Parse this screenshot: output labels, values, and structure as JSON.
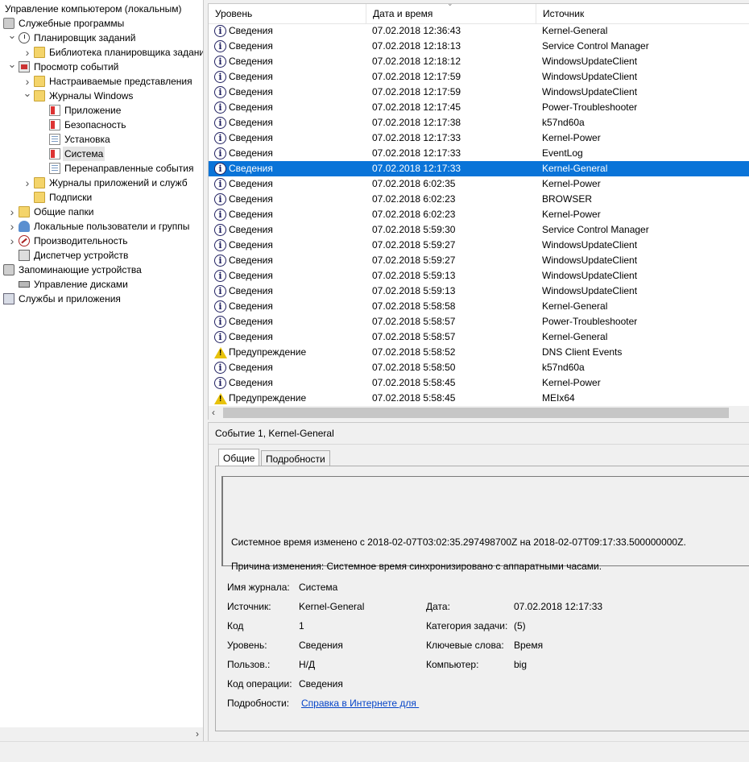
{
  "tree": {
    "items": [
      {
        "label": "Управление компьютером (локальным)",
        "indent": 0,
        "arrow": "",
        "icon": "computer-management-icon",
        "iconClass": "",
        "selected": false
      },
      {
        "label": "Служебные программы",
        "indent": 0,
        "arrow": "",
        "icon": "tools-icon",
        "iconClass": "ic-tools",
        "selected": false
      },
      {
        "label": "Планировщик заданий",
        "indent": 1,
        "arrow": "down",
        "icon": "clock-icon",
        "iconClass": "ic-clock",
        "selected": false
      },
      {
        "label": "Библиотека планировщика заданий",
        "indent": 2,
        "arrow": "right",
        "icon": "folder-icon",
        "iconClass": "ic-folder",
        "selected": false
      },
      {
        "label": "Просмотр событий",
        "indent": 1,
        "arrow": "down",
        "icon": "event-viewer-icon",
        "iconClass": "ic-ev",
        "selected": false
      },
      {
        "label": "Настраиваемые представления",
        "indent": 2,
        "arrow": "right",
        "icon": "folder-icon",
        "iconClass": "ic-folder",
        "selected": false
      },
      {
        "label": "Журналы Windows",
        "indent": 2,
        "arrow": "down",
        "icon": "windows-logs-icon",
        "iconClass": "ic-folder",
        "selected": false
      },
      {
        "label": "Приложение",
        "indent": 3,
        "arrow": "",
        "icon": "log-icon",
        "iconClass": "ic-logs",
        "selected": false
      },
      {
        "label": "Безопасность",
        "indent": 3,
        "arrow": "",
        "icon": "log-icon",
        "iconClass": "ic-logs",
        "selected": false
      },
      {
        "label": "Установка",
        "indent": 3,
        "arrow": "",
        "icon": "log-icon",
        "iconClass": "ic-log",
        "selected": false
      },
      {
        "label": "Система",
        "indent": 3,
        "arrow": "",
        "icon": "log-icon",
        "iconClass": "ic-logs",
        "selected": true
      },
      {
        "label": "Перенаправленные события",
        "indent": 3,
        "arrow": "",
        "icon": "log-icon",
        "iconClass": "ic-log",
        "selected": false
      },
      {
        "label": "Журналы приложений и служб",
        "indent": 2,
        "arrow": "right",
        "icon": "folder-icon",
        "iconClass": "ic-folder",
        "selected": false
      },
      {
        "label": "Подписки",
        "indent": 2,
        "arrow": "",
        "icon": "subscriptions-icon",
        "iconClass": "ic-folder",
        "selected": false
      },
      {
        "label": "Общие папки",
        "indent": 1,
        "arrow": "right",
        "icon": "shared-folders-icon",
        "iconClass": "ic-folder",
        "selected": false
      },
      {
        "label": "Локальные пользователи и группы",
        "indent": 1,
        "arrow": "right",
        "icon": "users-icon",
        "iconClass": "ic-users",
        "selected": false
      },
      {
        "label": "Производительность",
        "indent": 1,
        "arrow": "right",
        "icon": "performance-icon",
        "iconClass": "ic-perf",
        "selected": false
      },
      {
        "label": "Диспетчер устройств",
        "indent": 1,
        "arrow": "",
        "icon": "device-manager-icon",
        "iconClass": "ic-dev",
        "selected": false
      },
      {
        "label": "Запоминающие устройства",
        "indent": 0,
        "arrow": "",
        "icon": "storage-icon",
        "iconClass": "ic-storage",
        "selected": false
      },
      {
        "label": "Управление дисками",
        "indent": 1,
        "arrow": "",
        "icon": "disk-icon",
        "iconClass": "ic-disk",
        "selected": false
      },
      {
        "label": "Службы и приложения",
        "indent": 0,
        "arrow": "",
        "icon": "services-icon",
        "iconClass": "ic-svc",
        "selected": false
      }
    ]
  },
  "list": {
    "columns": {
      "level": "Уровень",
      "datetime": "Дата и время",
      "source": "Источник"
    },
    "rows": [
      {
        "level": "Сведения",
        "type": "info",
        "datetime": "07.02.2018 12:36:43",
        "source": "Kernel-General",
        "selected": false
      },
      {
        "level": "Сведения",
        "type": "info",
        "datetime": "07.02.2018 12:18:13",
        "source": "Service Control Manager",
        "selected": false
      },
      {
        "level": "Сведения",
        "type": "info",
        "datetime": "07.02.2018 12:18:12",
        "source": "WindowsUpdateClient",
        "selected": false
      },
      {
        "level": "Сведения",
        "type": "info",
        "datetime": "07.02.2018 12:17:59",
        "source": "WindowsUpdateClient",
        "selected": false
      },
      {
        "level": "Сведения",
        "type": "info",
        "datetime": "07.02.2018 12:17:59",
        "source": "WindowsUpdateClient",
        "selected": false
      },
      {
        "level": "Сведения",
        "type": "info",
        "datetime": "07.02.2018 12:17:45",
        "source": "Power-Troubleshooter",
        "selected": false
      },
      {
        "level": "Сведения",
        "type": "info",
        "datetime": "07.02.2018 12:17:38",
        "source": "k57nd60a",
        "selected": false
      },
      {
        "level": "Сведения",
        "type": "info",
        "datetime": "07.02.2018 12:17:33",
        "source": "Kernel-Power",
        "selected": false
      },
      {
        "level": "Сведения",
        "type": "info",
        "datetime": "07.02.2018 12:17:33",
        "source": "EventLog",
        "selected": false
      },
      {
        "level": "Сведения",
        "type": "info",
        "datetime": "07.02.2018 12:17:33",
        "source": "Kernel-General",
        "selected": true
      },
      {
        "level": "Сведения",
        "type": "info",
        "datetime": "07.02.2018 6:02:35",
        "source": "Kernel-Power",
        "selected": false
      },
      {
        "level": "Сведения",
        "type": "info",
        "datetime": "07.02.2018 6:02:23",
        "source": "BROWSER",
        "selected": false
      },
      {
        "level": "Сведения",
        "type": "info",
        "datetime": "07.02.2018 6:02:23",
        "source": "Kernel-Power",
        "selected": false
      },
      {
        "level": "Сведения",
        "type": "info",
        "datetime": "07.02.2018 5:59:30",
        "source": "Service Control Manager",
        "selected": false
      },
      {
        "level": "Сведения",
        "type": "info",
        "datetime": "07.02.2018 5:59:27",
        "source": "WindowsUpdateClient",
        "selected": false
      },
      {
        "level": "Сведения",
        "type": "info",
        "datetime": "07.02.2018 5:59:27",
        "source": "WindowsUpdateClient",
        "selected": false
      },
      {
        "level": "Сведения",
        "type": "info",
        "datetime": "07.02.2018 5:59:13",
        "source": "WindowsUpdateClient",
        "selected": false
      },
      {
        "level": "Сведения",
        "type": "info",
        "datetime": "07.02.2018 5:59:13",
        "source": "WindowsUpdateClient",
        "selected": false
      },
      {
        "level": "Сведения",
        "type": "info",
        "datetime": "07.02.2018 5:58:58",
        "source": "Kernel-General",
        "selected": false
      },
      {
        "level": "Сведения",
        "type": "info",
        "datetime": "07.02.2018 5:58:57",
        "source": "Power-Troubleshooter",
        "selected": false
      },
      {
        "level": "Сведения",
        "type": "info",
        "datetime": "07.02.2018 5:58:57",
        "source": "Kernel-General",
        "selected": false
      },
      {
        "level": "Предупреждение",
        "type": "warning",
        "datetime": "07.02.2018 5:58:52",
        "source": "DNS Client Events",
        "selected": false
      },
      {
        "level": "Сведения",
        "type": "info",
        "datetime": "07.02.2018 5:58:50",
        "source": "k57nd60a",
        "selected": false
      },
      {
        "level": "Сведения",
        "type": "info",
        "datetime": "07.02.2018 5:58:45",
        "source": "Kernel-Power",
        "selected": false
      },
      {
        "level": "Предупреждение",
        "type": "warning",
        "datetime": "07.02.2018 5:58:45",
        "source": "MEIx64",
        "selected": false
      }
    ]
  },
  "details": {
    "title": "Событие 1, Kernel-General",
    "tabs": {
      "general": "Общие",
      "details": "Подробности"
    },
    "description": {
      "line1": "Системное время изменено с 2018-02-07T03:02:35.297498700Z на 2018-02-07T09:17:33.500000000Z.",
      "line2": "Причина изменения: Системное время синхронизировано с аппаратными часами."
    },
    "fields": {
      "log_name_label": "Имя журнала:",
      "log_name": "Система",
      "source_label": "Источник:",
      "source": "Kernel-General",
      "date_label": "Дата:",
      "date": "07.02.2018 12:17:33",
      "code_label": "Код",
      "code": "1",
      "task_label": "Категория задачи:",
      "task": "(5)",
      "level_label": "Уровень:",
      "level": "Сведения",
      "keywords_label": "Ключевые слова:",
      "keywords": "Время",
      "user_label": "Пользов.:",
      "user": "Н/Д",
      "computer_label": "Компьютер:",
      "computer": "big",
      "opcode_label": "Код операции:",
      "opcode": "Сведения",
      "more_label": "Подробности:",
      "more_link": "Справка в Интернете для "
    }
  }
}
